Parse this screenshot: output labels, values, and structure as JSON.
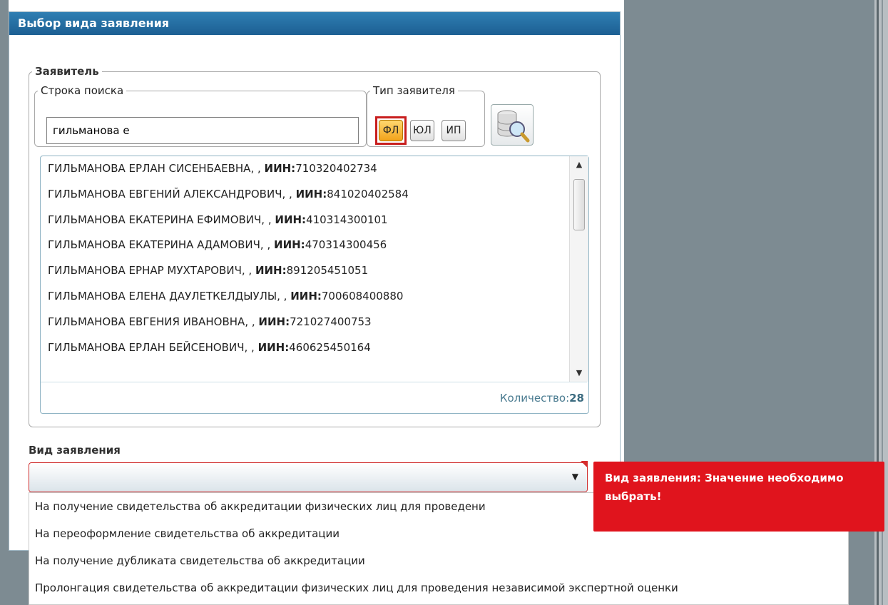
{
  "window": {
    "title": "Выбор вида заявления"
  },
  "applicant": {
    "group_label": "Заявитель",
    "search_label": "Строка поиска",
    "search_value": "гильманова е",
    "type_label": "Тип заявителя",
    "type_buttons": [
      {
        "label": "ФЛ",
        "selected": true
      },
      {
        "label": "ЮЛ",
        "selected": false
      },
      {
        "label": "ИП",
        "selected": false
      }
    ]
  },
  "results": {
    "iin_label": "ИИН:",
    "items": [
      {
        "name": "ГИЛЬМАНОВА ЕРЛАН СИСЕНБАЕВНА, , ",
        "iin": "710320402734"
      },
      {
        "name": "ГИЛЬМАНОВА ЕВГЕНИЙ АЛЕКСАНДРОВИЧ, , ",
        "iin": "841020402584"
      },
      {
        "name": "ГИЛЬМАНОВА ЕКАТЕРИНА ЕФИМОВИЧ, , ",
        "iin": "410314300101"
      },
      {
        "name": "ГИЛЬМАНОВА ЕКАТЕРИНА АДАМОВИЧ, , ",
        "iin": "470314300456"
      },
      {
        "name": "ГИЛЬМАНОВА ЕРНАР МУХТАРОВИЧ, , ",
        "iin": "891205451051"
      },
      {
        "name": "ГИЛЬМАНОВА ЕЛЕНА ДАУЛЕТКЕЛДЫУЛЫ, , ",
        "iin": "700608400880"
      },
      {
        "name": "ГИЛЬМАНОВА ЕВГЕНИЯ ИВАНОВНА, , ",
        "iin": "721027400753"
      },
      {
        "name": "ГИЛЬМАНОВА ЕРЛАН БЕЙСЕНОВИЧ, , ",
        "iin": "460625450164"
      }
    ],
    "count_label": "Количество:",
    "count_value": "28"
  },
  "application_kind": {
    "label": "Вид заявления",
    "value": "",
    "error": "Вид заявления: Значение необходимо выбрать!",
    "options": [
      "На получение свидетельства об аккредитации физических лиц для проведени",
      "На переоформление свидетельства об аккредитации",
      "На получение дубликата свидетельства об аккредитации",
      "Пролонгация свидетельства об аккредитации физических лиц для проведения независимой экспертной оценки"
    ]
  },
  "colors": {
    "title_bar": "#1c5f93",
    "error": "#e0141d",
    "selected_type": "#f2a21a"
  }
}
